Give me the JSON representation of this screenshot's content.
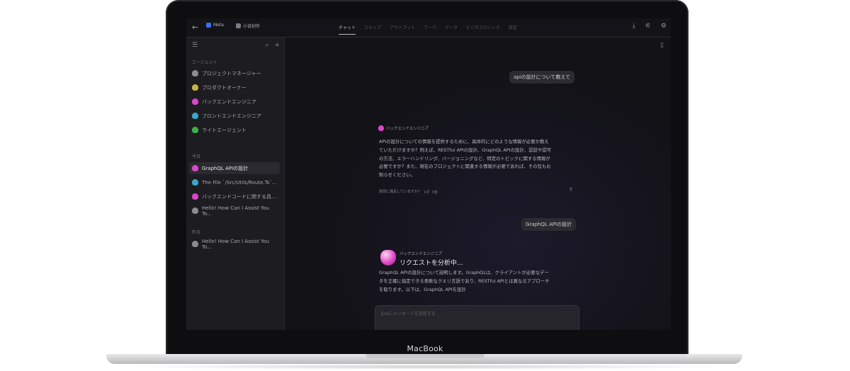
{
  "device": {
    "brand_label": "MacBook"
  },
  "topbar": {
    "back_icon": "←",
    "chip1": {
      "label": "Meta",
      "color": "#3d6ff0"
    },
    "chip2": {
      "label": "小说创作",
      "color": "#7b7b85"
    },
    "tabs": [
      "チャット",
      "ステップ",
      "アウトプット",
      "ワーク",
      "データ",
      "ビジネスロジック",
      "設定"
    ],
    "active_tab": "チャット",
    "icons": [
      "download-icon",
      "sliders-icon",
      "gear-icon"
    ]
  },
  "sidebar": {
    "header_icons": [
      "menu-icon",
      "search-icon",
      "plus-icon"
    ],
    "agents_title": "エージェント",
    "agents": [
      {
        "label": "プロジェクトマネージャー",
        "color": "#8c8c8c"
      },
      {
        "label": "プロダクトオーナー",
        "color": "#c8b340"
      },
      {
        "label": "バックエンドエンジニア",
        "color": "#d946c8"
      },
      {
        "label": "フロントエンドエンジニア",
        "color": "#3aa7c9"
      },
      {
        "label": "ライトエージェント",
        "color": "#3fae4a"
      }
    ],
    "today_title": "今日",
    "today": [
      {
        "label": "GraphQL APIの設計",
        "color": "#d946c8",
        "selected": true
      },
      {
        "label": "The File `/Src/Utils/Route.Ts`...",
        "color": "#3aa7c9"
      },
      {
        "label": "バックエンドコードに関する具...",
        "color": "#d946c8"
      },
      {
        "label": "Hello! How Can I Assist You To...",
        "color": "#8c8c8c"
      }
    ],
    "yesterday_title": "昨日",
    "yesterday": [
      {
        "label": "Hello! How Can I Assist You To...",
        "color": "#8c8c8c"
      }
    ]
  },
  "chat": {
    "expand_icon": "▯",
    "user_msg1": "apiの設計について教えて",
    "agent_name": "バックエンドエンジニア",
    "agent_msg1_lines": [
      "APIの設計についての情報を提供するために、具体的にどのような情報が必要か教え",
      "ていただけますか？例えば、RESTful APIの設計、GraphQL APIの設計、認証や認可",
      "の方法、エラーハンドリング、バージョニングなど、特定のトピックに関する情報が",
      "必要ですか？また、現在のプロジェクトに関連する情報が必要であれば、その旨もお",
      "知らせください。"
    ],
    "feedback_label": "質問に満足していますか？",
    "feedback_icons": [
      "thumbs-up-icon",
      "thumbs-down-icon"
    ],
    "copy_icon": "⎘",
    "user_msg2": "GraphQL APIの設計",
    "agent_name2": "バックエンドエンジニア",
    "status": "リクエストを分析中...",
    "agent_msg2_lines": [
      "GraphQL APIの設計について説明します。GraphQLは、クライアントが必要なデー",
      "タを正確に指定できる柔軟なクエリ言語であり、RESTful APIとは異なるアプローチ",
      "を取ります。以下は、GraphQL APIを設計"
    ],
    "composer_placeholder": "Jinaにメッセージを送信する"
  }
}
